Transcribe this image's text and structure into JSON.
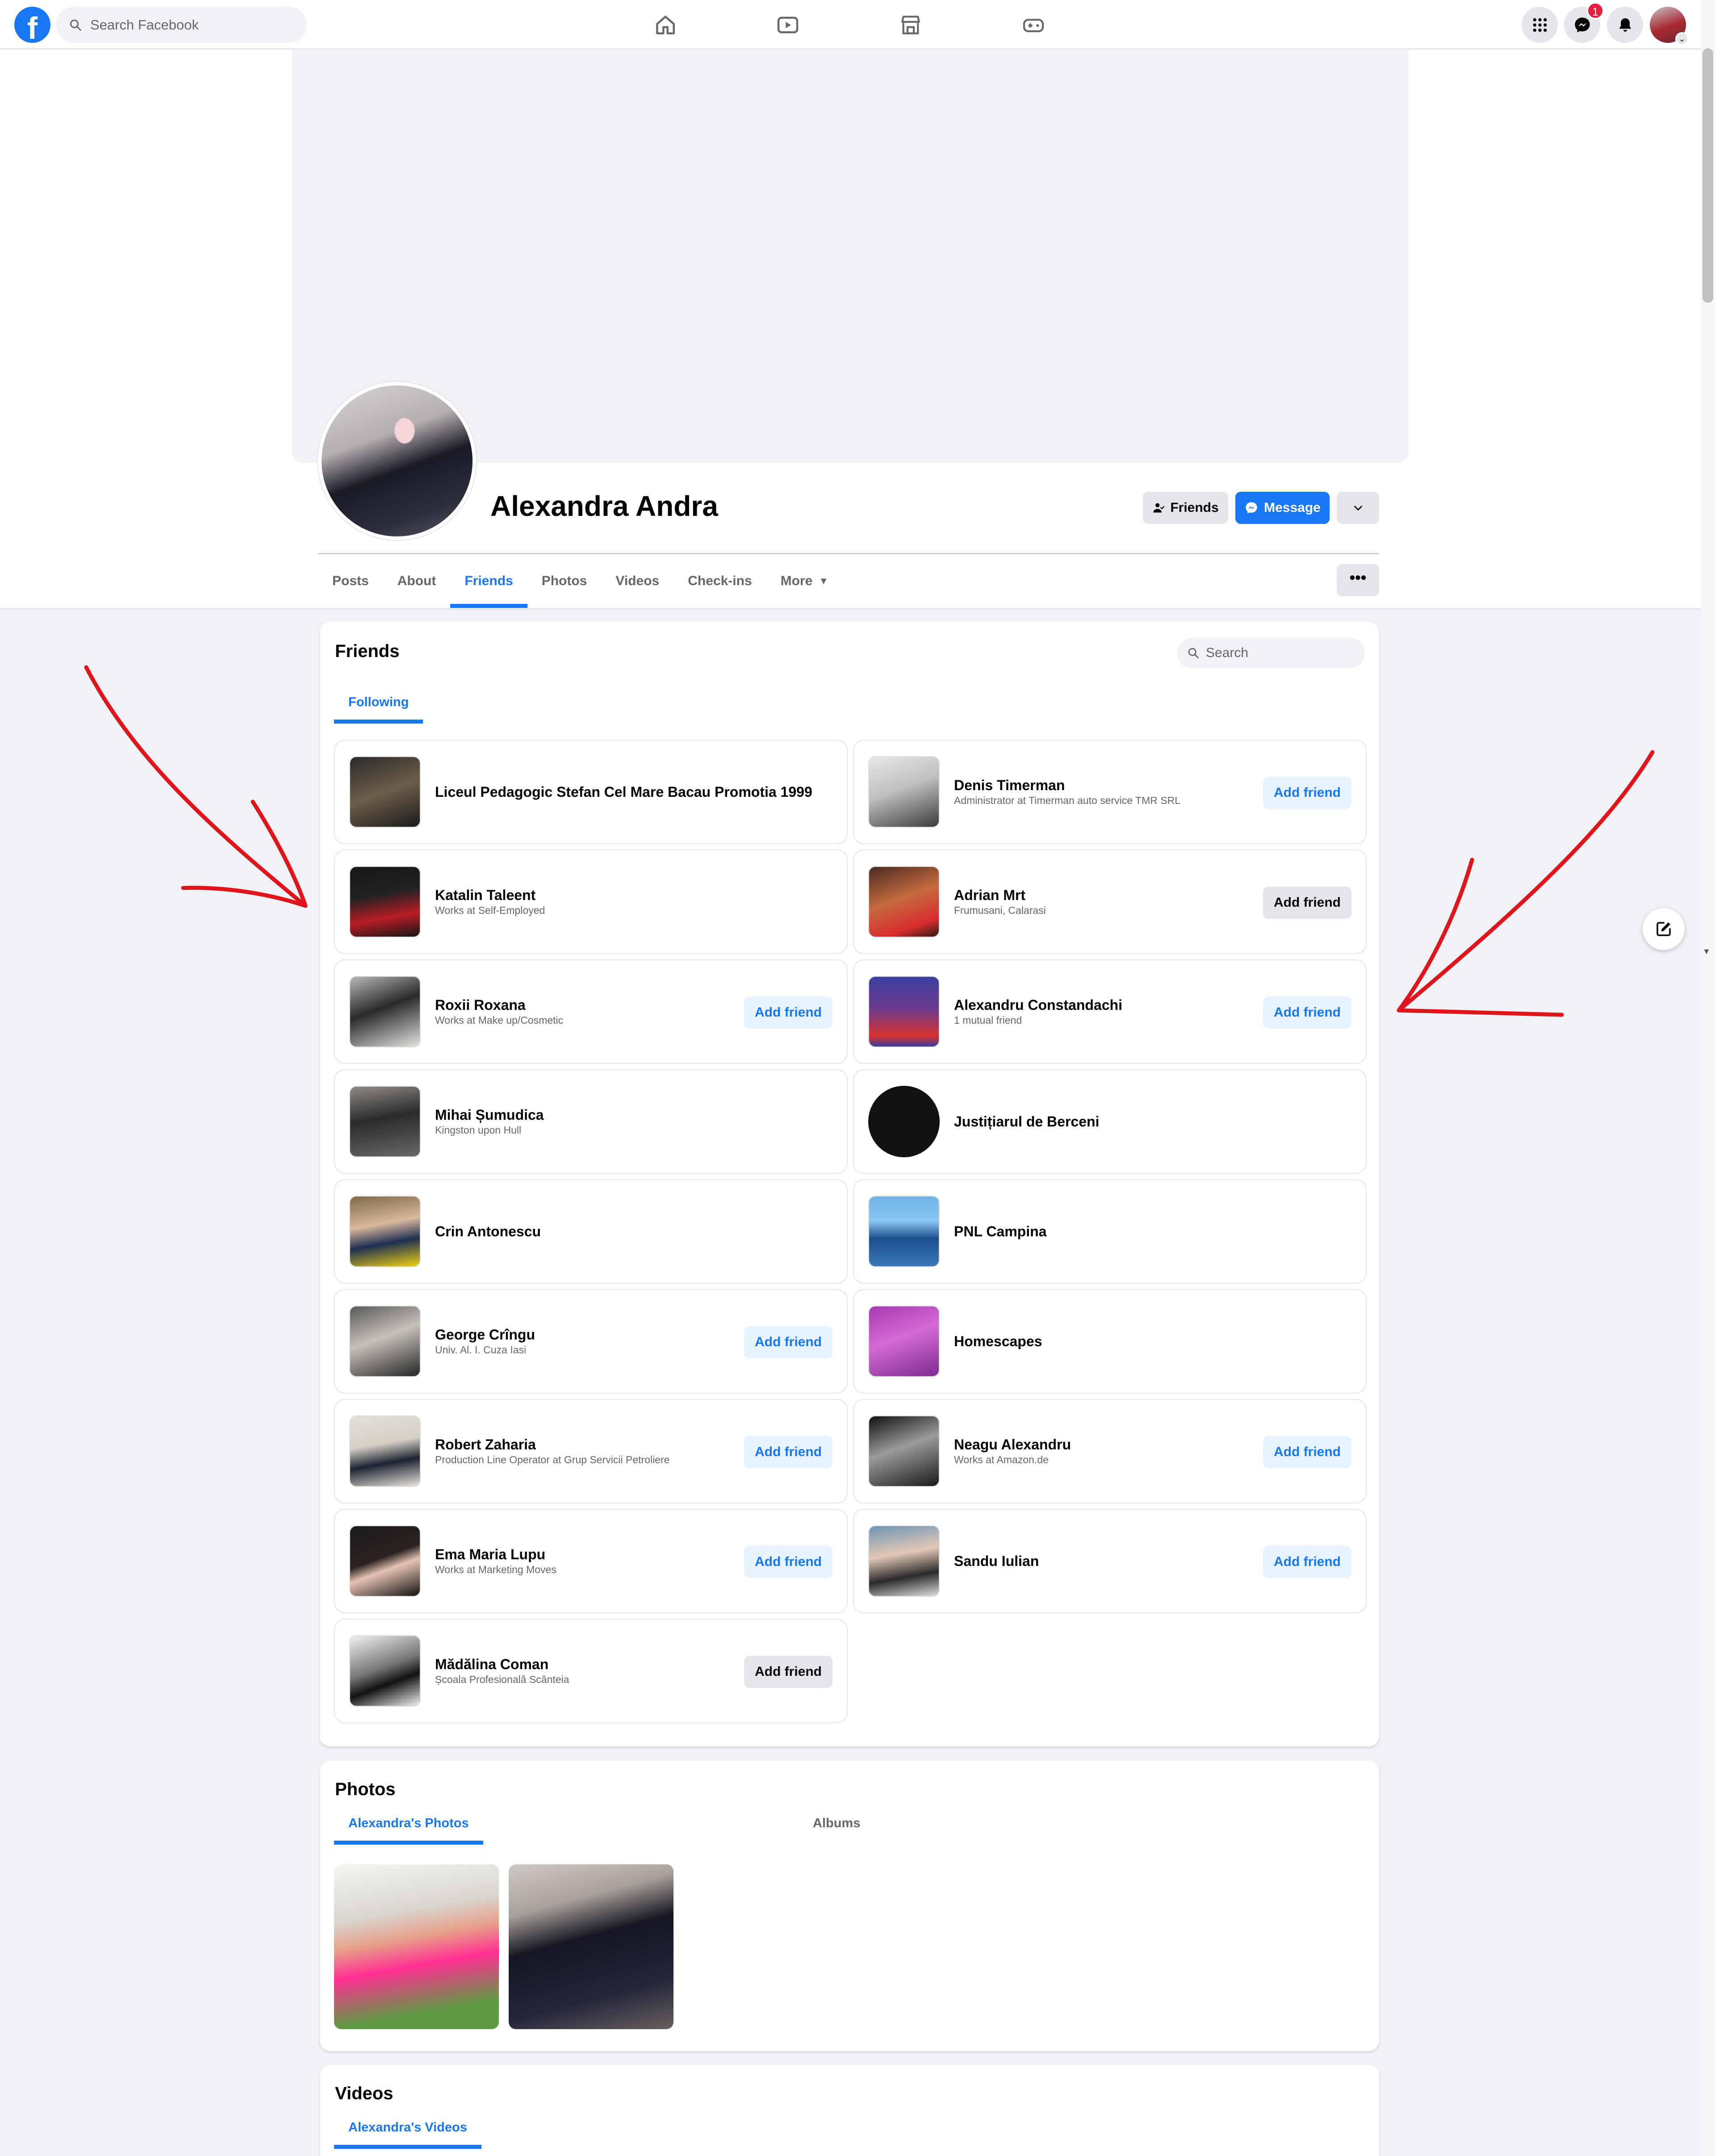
{
  "topbar": {
    "logo": "f",
    "search_placeholder": "Search Facebook",
    "nav_icons": [
      "home-icon",
      "watch-icon",
      "marketplace-icon",
      "gaming-icon"
    ],
    "right_icons": [
      "menu-grid-icon",
      "messenger-icon",
      "notifications-bell-icon"
    ],
    "messenger_badge": "1"
  },
  "profile": {
    "name": "Alexandra Andra",
    "friends_button": "Friends",
    "message_button": "Message",
    "tabs": [
      "Posts",
      "About",
      "Friends",
      "Photos",
      "Videos",
      "Check-ins",
      "More"
    ],
    "active_tab": "Friends",
    "more_options": "•••"
  },
  "friends_section": {
    "title": "Friends",
    "search_placeholder": "Search",
    "subtab": "Following",
    "items": [
      {
        "name": "Liceul Pedagogic Stefan Cel Mare Bacau Promotia 1999",
        "sub": "",
        "button": "",
        "thumb": "linear-gradient(160deg,#2b2a2a,#6c5e4a 50%,#1b1b1b)",
        "round": false
      },
      {
        "name": "Denis Timerman",
        "sub": "Administrator at Timerman auto service TMR SRL",
        "button": "Add friend",
        "style": "blue",
        "thumb": "linear-gradient(160deg,#e8e8e6,#c2c0bf 45%,#3c3b3b)",
        "round": false
      },
      {
        "name": "Katalin Taleent",
        "sub": "Works at Self-Employed",
        "button": "",
        "thumb": "linear-gradient(170deg,#171717,#222 40%,#b81d24 70%,#161616)",
        "round": false
      },
      {
        "name": "Adrian Mrt",
        "sub": "Frumusani, Calarasi",
        "button": "Add friend",
        "style": "grey",
        "thumb": "linear-gradient(160deg,#4a2a22,#c46b3f 45%,#d92d2d 80%,#2d1a16)",
        "round": false
      },
      {
        "name": "Roxii Roxana",
        "sub": "Works at Make up/Cosmetic",
        "button": "Add friend",
        "style": "blue",
        "thumb": "linear-gradient(160deg,#b7b9b9,#2b2929 45%,#e4e2df)",
        "round": false
      },
      {
        "name": "Alexandru Constandachi",
        "sub": "1 mutual friend",
        "button": "Add friend",
        "style": "blue",
        "thumb": "linear-gradient(180deg,#3c3f9e,#6a3a8f 45%,#d6322f 85%,#3a3ba1)",
        "round": false
      },
      {
        "name": "Mihai Șumudica",
        "sub": "Kingston upon Hull",
        "button": "",
        "thumb": "linear-gradient(170deg,#8f8b87,#2b2b2b 45%,#68676a)",
        "round": false
      },
      {
        "name": "Justițiarul de Berceni",
        "sub": "",
        "button": "",
        "thumb": "#111111",
        "round": true
      },
      {
        "name": "Crin Antonescu",
        "sub": "",
        "button": "",
        "thumb": "linear-gradient(170deg,#7d6a48,#d9b89c 40%,#1e2f52 65%,#efd112)",
        "round": false
      },
      {
        "name": "PNL Campina",
        "sub": "",
        "button": "",
        "thumb": "linear-gradient(180deg,#6fb3e8,#8ac7f0 35%,#1c4f8c 60%,#3c78b8)",
        "round": false
      },
      {
        "name": "George Crîngu",
        "sub": "Univ. Al. I. Cuza Iasi",
        "button": "Add friend",
        "style": "blue",
        "thumb": "linear-gradient(160deg,#5a5a5a,#c5c0b9 45%,#262626)",
        "round": false
      },
      {
        "name": "Homescapes",
        "sub": "",
        "button": "",
        "thumb": "linear-gradient(160deg,#a93ab1,#d36ad6 45%,#7f2a91)",
        "round": false
      },
      {
        "name": "Robert Zaharia",
        "sub": "Production Line Operator at Grup Servicii Petroliere",
        "button": "Add friend",
        "style": "blue",
        "thumb": "linear-gradient(170deg,#e4e0da,#d5cfc5 40%,#1d2430 65%,#e8e3dd)",
        "round": false
      },
      {
        "name": "Neagu Alexandru",
        "sub": "Works at Amazon.de",
        "button": "Add friend",
        "style": "blue",
        "thumb": "linear-gradient(160deg,#101010,#9b9b9b 45%,#1a1a1a)",
        "round": false
      },
      {
        "name": "Ema Maria Lupu",
        "sub": "Works at Marketing Moves",
        "button": "Add friend",
        "style": "blue",
        "thumb": "linear-gradient(160deg,#1b1b1b,#2a2220 45%,#e6c3b3 60%,#111)",
        "round": false
      },
      {
        "name": "Sandu Iulian",
        "sub": "",
        "button": "Add friend",
        "style": "blue",
        "thumb": "linear-gradient(170deg,#6e95b4,#e3c8b6 40%,#2a2a2a 70%,#ddd)",
        "round": false
      },
      {
        "name": "Mădălina Coman",
        "sub": "Școala Profesională Scânteia",
        "button": "Add friend",
        "style": "grey",
        "thumb": "linear-gradient(160deg,#f2f2f2,#777 45%,#121212 65%,#f0f0f0)",
        "round": false
      }
    ]
  },
  "photos_section": {
    "title": "Photos",
    "tabs": [
      "Alexandra's Photos",
      "Albums"
    ],
    "photos": [
      "linear-gradient(170deg,#f5f5f3 0%,#d9d6d0 30%,#e7a089 45%,#ff2f92 60%,#5e9a43 85%)",
      "linear-gradient(165deg,#cfc9c5 0%,#a9a19c 25%,#151621 45%,#23253a 75%,#68605d 100%)"
    ]
  },
  "videos_section": {
    "title": "Videos",
    "tabs": [
      "Alexandra's Videos"
    ]
  },
  "annotation_color": "#e0151b"
}
